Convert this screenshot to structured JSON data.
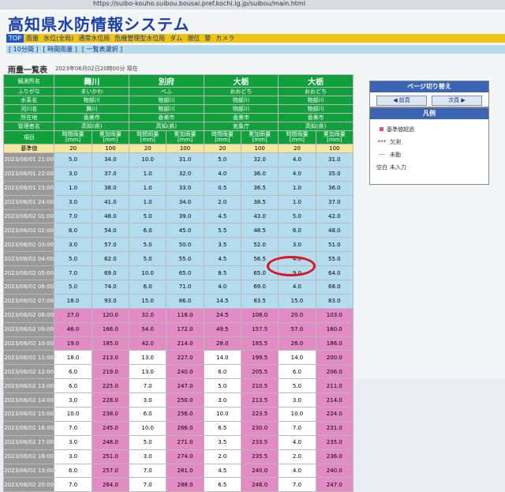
{
  "browser": {
    "url": "https://suibo-kouho.suibou.bousai.pref.kochi.lg.jp/suibou/main.html"
  },
  "site": {
    "title": "高知県水防情報システム"
  },
  "nav": {
    "items": [
      "TOP",
      "雨量",
      "水位(全局)",
      "通常水位局",
      "危機管理型水位局",
      "ダム",
      "潮位",
      "警",
      "カメラ"
    ]
  },
  "subnav": {
    "items": [
      "[ 10分間 ]",
      "[ 時間雨量 ]",
      "[ 一覧表選択 ]"
    ]
  },
  "page": {
    "heading": "雨量一覧表",
    "timestamp": "2023年06月02日20時00分 現在"
  },
  "table": {
    "label_header": "観測所名",
    "label_rows": [
      "ふりがな",
      "水系名",
      "河川名",
      "所在地",
      "管理者名",
      "項目"
    ],
    "base_label": "基準値",
    "stations": [
      {
        "name": "舞川",
        "info": [
          "まいかわ",
          "物部川",
          "舞川",
          "香美市",
          "高知(県)"
        ]
      },
      {
        "name": "別府",
        "info": [
          "べふ",
          "物部川",
          "物部川",
          "香美市",
          "高知(県)"
        ]
      },
      {
        "name": "大栃",
        "info": [
          "おおどち",
          "物部川",
          "物部川",
          "香美市",
          "気象庁"
        ]
      },
      {
        "name": "大栃",
        "info": [
          "おおどち",
          "物部川",
          "物部川",
          "香美市",
          "高知(県)"
        ]
      }
    ],
    "col_hourly": "時間雨量",
    "col_cumulative": "累加雨量",
    "unit": "[mm]",
    "base_values": [
      "20",
      "100",
      "20",
      "100",
      "20",
      "100",
      "20",
      "100"
    ],
    "rows": [
      {
        "date": "2023/06/01 21:00",
        "v": [
          "5.0",
          "34.0",
          "10.0",
          "31.0",
          "5.0",
          "32.0",
          "4.0",
          "31.0"
        ]
      },
      {
        "date": "2023/06/01 22:00",
        "v": [
          "3.0",
          "37.0",
          "1.0",
          "32.0",
          "4.0",
          "36.0",
          "4.0",
          "35.0"
        ]
      },
      {
        "date": "2023/06/01 23:00",
        "v": [
          "1.0",
          "38.0",
          "1.0",
          "33.0",
          "0.5",
          "36.5",
          "1.0",
          "36.0"
        ]
      },
      {
        "date": "2023/06/01 24:00",
        "v": [
          "3.0",
          "41.0",
          "1.0",
          "34.0",
          "2.0",
          "38.5",
          "1.0",
          "37.0"
        ]
      },
      {
        "date": "2023/06/02 01:00",
        "v": [
          "7.0",
          "48.0",
          "5.0",
          "39.0",
          "4.5",
          "43.0",
          "5.0",
          "42.0"
        ]
      },
      {
        "date": "2023/06/02 02:00",
        "v": [
          "6.0",
          "54.0",
          "6.0",
          "45.0",
          "5.5",
          "48.5",
          "6.0",
          "48.0"
        ]
      },
      {
        "date": "2023/06/02 03:00",
        "v": [
          "3.0",
          "57.0",
          "5.0",
          "50.0",
          "3.5",
          "52.0",
          "3.0",
          "51.0"
        ]
      },
      {
        "date": "2023/06/02 04:00",
        "v": [
          "5.0",
          "62.0",
          "5.0",
          "55.0",
          "4.5",
          "56.5",
          "4.0",
          "55.0"
        ]
      },
      {
        "date": "2023/06/02 05:00",
        "v": [
          "7.0",
          "69.0",
          "10.0",
          "65.0",
          "8.5",
          "65.0",
          "9.0",
          "64.0"
        ]
      },
      {
        "date": "2023/06/02 06:00",
        "v": [
          "5.0",
          "74.0",
          "6.0",
          "71.0",
          "4.0",
          "69.0",
          "4.0",
          "68.0"
        ]
      },
      {
        "date": "2023/06/02 07:00",
        "v": [
          "18.0",
          "93.0",
          "15.0",
          "86.0",
          "14.5",
          "83.5",
          "15.0",
          "83.0"
        ]
      },
      {
        "date": "2023/06/02 08:00",
        "v": [
          "27.0",
          "120.0",
          "32.0",
          "118.0",
          "24.5",
          "108.0",
          "20.0",
          "103.0"
        ]
      },
      {
        "date": "2023/06/02 09:00",
        "v": [
          "46.0",
          "166.0",
          "54.0",
          "172.0",
          "49.5",
          "157.5",
          "57.0",
          "160.0"
        ]
      },
      {
        "date": "2023/06/02 10:00",
        "v": [
          "19.0",
          "185.0",
          "42.0",
          "214.0",
          "28.0",
          "185.5",
          "26.0",
          "186.0"
        ]
      },
      {
        "date": "2023/06/02 11:00",
        "v": [
          "18.0",
          "213.0",
          "13.0",
          "227.0",
          "14.0",
          "199.5",
          "14.0",
          "200.0"
        ]
      },
      {
        "date": "2023/06/02 12:00",
        "v": [
          "6.0",
          "219.0",
          "13.0",
          "240.0",
          "6.0",
          "205.5",
          "6.0",
          "206.0"
        ]
      },
      {
        "date": "2023/06/02 13:00",
        "v": [
          "6.0",
          "225.0",
          "7.0",
          "247.0",
          "5.0",
          "210.5",
          "5.0",
          "211.0"
        ]
      },
      {
        "date": "2023/06/02 14:00",
        "v": [
          "3.0",
          "228.0",
          "3.0",
          "250.0",
          "3.0",
          "213.5",
          "3.0",
          "214.0"
        ]
      },
      {
        "date": "2023/06/02 15:00",
        "v": [
          "10.0",
          "238.0",
          "6.0",
          "256.0",
          "10.0",
          "223.5",
          "10.0",
          "224.0"
        ]
      },
      {
        "date": "2023/06/02 16:00",
        "v": [
          "7.0",
          "245.0",
          "10.0",
          "266.0",
          "6.5",
          "230.0",
          "7.0",
          "231.0"
        ]
      },
      {
        "date": "2023/06/02 17:00",
        "v": [
          "3.0",
          "248.0",
          "5.0",
          "271.0",
          "3.5",
          "233.5",
          "4.0",
          "235.0"
        ]
      },
      {
        "date": "2023/06/02 18:00",
        "v": [
          "3.0",
          "251.0",
          "3.0",
          "274.0",
          "2.0",
          "235.5",
          "2.0",
          "236.0"
        ]
      },
      {
        "date": "2023/06/02 19:00",
        "v": [
          "6.0",
          "257.0",
          "7.0",
          "281.0",
          "4.5",
          "240.0",
          "4.0",
          "240.0"
        ]
      },
      {
        "date": "2023/06/02 20:00",
        "v": [
          "7.0",
          "264.0",
          "7.0",
          "288.0",
          "6.5",
          "246.0",
          "7.0",
          "247.0"
        ]
      }
    ]
  },
  "page_switch": {
    "title": "ページ切り替え",
    "prev": "◀ 前頁",
    "next": "次頁 ▶"
  },
  "legend": {
    "title": "凡例",
    "items": [
      {
        "sym": "",
        "label": "基準値超過"
      },
      {
        "sym": "***",
        "label": "欠測"
      },
      {
        "sym": "---",
        "label": "未動"
      },
      {
        "sym": "空白",
        "label": "未入力"
      }
    ]
  },
  "colors": {
    "exceed": "#e38bc4",
    "normal_cyan": "#b3dcee",
    "header_green": "#12a03d",
    "base_yellow": "#f5e6a0",
    "nav_yellow": "#f1c40f",
    "panel_blue": "#3b64b4",
    "annotation_red": "#e01020"
  }
}
